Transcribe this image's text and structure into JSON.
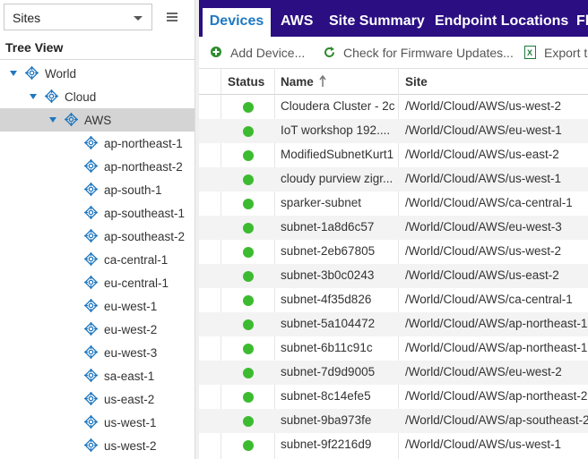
{
  "sidebar": {
    "select_value": "Sites",
    "tree_title": "Tree View",
    "nodes": [
      {
        "label": "World"
      },
      {
        "label": "Cloud"
      },
      {
        "label": "AWS"
      },
      {
        "label": "ap-northeast-1"
      },
      {
        "label": "ap-northeast-2"
      },
      {
        "label": "ap-south-1"
      },
      {
        "label": "ap-southeast-1"
      },
      {
        "label": "ap-southeast-2"
      },
      {
        "label": "ca-central-1"
      },
      {
        "label": "eu-central-1"
      },
      {
        "label": "eu-west-1"
      },
      {
        "label": "eu-west-2"
      },
      {
        "label": "eu-west-3"
      },
      {
        "label": "sa-east-1"
      },
      {
        "label": "us-east-2"
      },
      {
        "label": "us-west-1"
      },
      {
        "label": "us-west-2"
      }
    ]
  },
  "tabs": [
    {
      "label": "Devices"
    },
    {
      "label": "AWS"
    },
    {
      "label": "Site Summary"
    },
    {
      "label": "Endpoint Locations"
    },
    {
      "label": "Fl"
    }
  ],
  "toolbar": {
    "add_label": "Add Device...",
    "firmware_label": "Check for Firmware Updates...",
    "export_label": "Export to"
  },
  "grid": {
    "headers": {
      "status": "Status",
      "name": "Name",
      "site": "Site"
    },
    "rows": [
      {
        "name": "Cloudera Cluster - 2c",
        "site": "/World/Cloud/AWS/us-west-2"
      },
      {
        "name": "IoT workshop 192....",
        "site": "/World/Cloud/AWS/eu-west-1"
      },
      {
        "name": "ModifiedSubnetKurt1",
        "site": "/World/Cloud/AWS/us-east-2"
      },
      {
        "name": "cloudy purview zigr...",
        "site": "/World/Cloud/AWS/us-west-1"
      },
      {
        "name": "sparker-subnet",
        "site": "/World/Cloud/AWS/ca-central-1"
      },
      {
        "name": "subnet-1a8d6c57",
        "site": "/World/Cloud/AWS/eu-west-3"
      },
      {
        "name": "subnet-2eb67805",
        "site": "/World/Cloud/AWS/us-west-2"
      },
      {
        "name": "subnet-3b0c0243",
        "site": "/World/Cloud/AWS/us-east-2"
      },
      {
        "name": "subnet-4f35d826",
        "site": "/World/Cloud/AWS/ca-central-1"
      },
      {
        "name": "subnet-5a104472",
        "site": "/World/Cloud/AWS/ap-northeast-1"
      },
      {
        "name": "subnet-6b11c91c",
        "site": "/World/Cloud/AWS/ap-northeast-1"
      },
      {
        "name": "subnet-7d9d9005",
        "site": "/World/Cloud/AWS/eu-west-2"
      },
      {
        "name": "subnet-8c14efe5",
        "site": "/World/Cloud/AWS/ap-northeast-2"
      },
      {
        "name": "subnet-9ba973fe",
        "site": "/World/Cloud/AWS/ap-southeast-2"
      },
      {
        "name": "subnet-9f2216d9",
        "site": "/World/Cloud/AWS/us-west-1"
      }
    ]
  },
  "colors": {
    "tab_bar": "#2a0e82",
    "active_tab_text": "#1f78c1",
    "status_ok": "#3dbb30",
    "tree_icon": "#1f78c1"
  }
}
